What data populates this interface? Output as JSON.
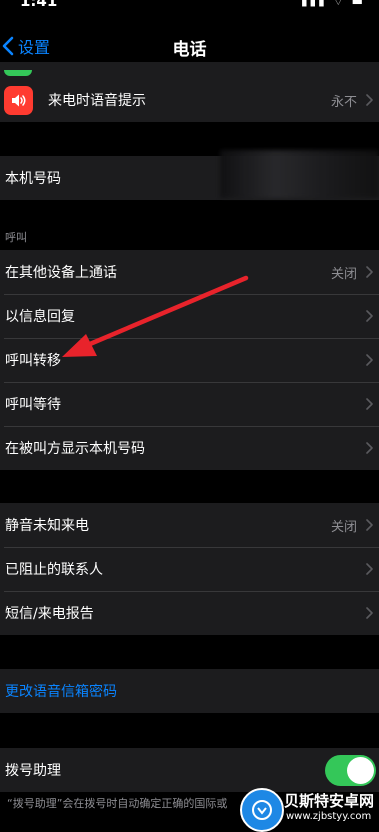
{
  "status_bar": {
    "time": "1:41",
    "icons": "▮▮▮ ⌔ ▬"
  },
  "nav": {
    "back_label": "设置",
    "title": "电话"
  },
  "announce_calls": {
    "label": "来电时语音提示",
    "value": "永不"
  },
  "my_number": {
    "label": "本机号码"
  },
  "calls_section": {
    "header": "呼叫",
    "rows": [
      {
        "label": "在其他设备上通话",
        "value": "关闭"
      },
      {
        "label": "以信息回复",
        "value": ""
      },
      {
        "label": "呼叫转移",
        "value": ""
      },
      {
        "label": "呼叫等待",
        "value": ""
      },
      {
        "label": "在被叫方显示本机号码",
        "value": ""
      }
    ]
  },
  "blocking_section": {
    "rows": [
      {
        "label": "静音未知来电",
        "value": "关闭"
      },
      {
        "label": "已阻止的联系人",
        "value": ""
      },
      {
        "label": "短信/来电报告",
        "value": ""
      }
    ]
  },
  "voicemail": {
    "link_label": "更改语音信箱密码"
  },
  "dial_assist": {
    "label": "拨号助理",
    "enabled": true,
    "note": "“拨号助理”会在拨号时自动确定正确的国际或"
  },
  "watermark": {
    "title": "贝斯特安卓网",
    "url": "www.zjbstyy.com"
  },
  "colors": {
    "accent": "#0a84ff",
    "switch_on": "#34c759",
    "annotation_arrow": "#e8232b",
    "speaker_icon_bg": "#ff3b30"
  }
}
